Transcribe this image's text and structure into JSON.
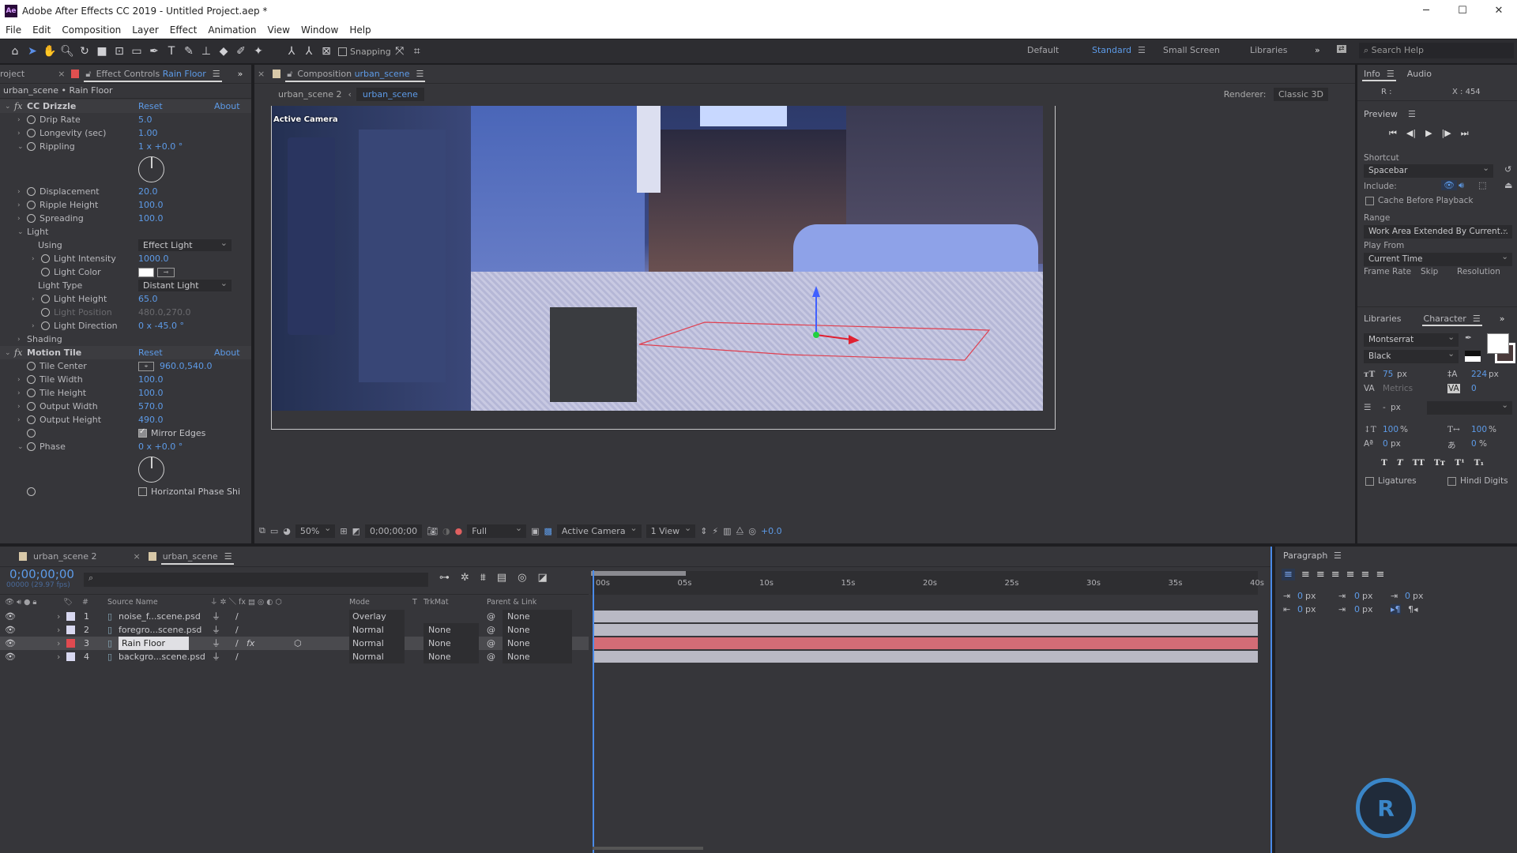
{
  "window": {
    "title": "Adobe After Effects CC 2019 - Untitled Project.aep *",
    "logo": "Ae",
    "controls": [
      "minimize-icon",
      "maximize-icon",
      "close-icon"
    ]
  },
  "menu": [
    "File",
    "Edit",
    "Composition",
    "Layer",
    "Effect",
    "Animation",
    "View",
    "Window",
    "Help"
  ],
  "toolbar": {
    "snapping": "Snapping",
    "workspaces": [
      "Default",
      "Standard",
      "Small Screen",
      "Libraries"
    ],
    "active_workspace": "Standard",
    "search_placeholder": "Search Help"
  },
  "effect_controls": {
    "project_tab": "roject",
    "tab_prefix": "Effect Controls",
    "tab_layer": "Rain Floor",
    "header": "urban_scene • Rain Floor",
    "reset": "Reset",
    "about": "About",
    "rows": [
      {
        "type": "header",
        "label": "CC Drizzle"
      },
      {
        "type": "value",
        "label": "Drip Rate",
        "value": "5.0",
        "exp": ">",
        "lvl": 1,
        "sw": true
      },
      {
        "type": "value",
        "label": "Longevity (sec)",
        "value": "1.00",
        "exp": ">",
        "lvl": 1,
        "sw": true
      },
      {
        "type": "value",
        "label": "Rippling",
        "value": "1 x +0.0 °",
        "exp": "v",
        "lvl": 1,
        "sw": true
      },
      {
        "type": "dial"
      },
      {
        "type": "value",
        "label": "Displacement",
        "value": "20.0",
        "exp": ">",
        "lvl": 1,
        "sw": true
      },
      {
        "type": "value",
        "label": "Ripple Height",
        "value": "100.0",
        "exp": ">",
        "lvl": 1,
        "sw": true
      },
      {
        "type": "value",
        "label": "Spreading",
        "value": "100.0",
        "exp": ">",
        "lvl": 1,
        "sw": true
      },
      {
        "type": "group",
        "label": "Light",
        "exp": "v",
        "lvl": 1
      },
      {
        "type": "dropdown",
        "label": "Using",
        "value": "Effect Light",
        "lvl": 2
      },
      {
        "type": "value",
        "label": "Light Intensity",
        "value": "1000.0",
        "exp": ">",
        "lvl": 2,
        "sw": true
      },
      {
        "type": "color",
        "label": "Light Color",
        "value": "#ffffff",
        "lvl": 2,
        "sw": true
      },
      {
        "type": "dropdown",
        "label": "Light Type",
        "value": "Distant Light",
        "lvl": 2
      },
      {
        "type": "value",
        "label": "Light Height",
        "value": "65.0",
        "exp": ">",
        "lvl": 2,
        "sw": true
      },
      {
        "type": "disabled",
        "label": "Light Position",
        "value": "480.0,270.0",
        "lvl": 2,
        "sw": true
      },
      {
        "type": "value",
        "label": "Light Direction",
        "value": "0 x -45.0 °",
        "exp": ">",
        "lvl": 2,
        "sw": true
      },
      {
        "type": "group",
        "label": "Shading",
        "exp": ">",
        "lvl": 1
      },
      {
        "type": "header",
        "label": "Motion Tile"
      },
      {
        "type": "point",
        "label": "Tile Center",
        "value": "960.0,540.0",
        "lvl": 1,
        "sw": true
      },
      {
        "type": "value",
        "label": "Tile Width",
        "value": "100.0",
        "exp": ">",
        "lvl": 1,
        "sw": true
      },
      {
        "type": "value",
        "label": "Tile Height",
        "value": "100.0",
        "exp": ">",
        "lvl": 1,
        "sw": true
      },
      {
        "type": "value",
        "label": "Output Width",
        "value": "570.0",
        "exp": ">",
        "lvl": 1,
        "sw": true
      },
      {
        "type": "value",
        "label": "Output Height",
        "value": "490.0",
        "exp": ">",
        "lvl": 1,
        "sw": true
      },
      {
        "type": "checkbox",
        "label": "",
        "value": "Mirror Edges",
        "checked": true,
        "lvl": 1,
        "sw": true
      },
      {
        "type": "value",
        "label": "Phase",
        "value": "0 x +0.0 °",
        "exp": "v",
        "lvl": 1,
        "sw": true
      },
      {
        "type": "dial"
      },
      {
        "type": "checkbox",
        "label": "",
        "value": "Horizontal Phase Shi",
        "checked": false,
        "lvl": 1,
        "sw": true
      }
    ]
  },
  "composition": {
    "tab_prefix": "Composition",
    "tab_name": "urban_scene",
    "subtabs": [
      "urban_scene 2",
      "urban_scene"
    ],
    "renderer_label": "Renderer:",
    "renderer": "Classic 3D",
    "view_label": "Active Camera",
    "bottom": {
      "zoom": "50%",
      "timecode": "0;00;00;00",
      "resolution": "Full",
      "camera": "Active Camera",
      "views": "1 View",
      "exposure": "+0.0"
    }
  },
  "info": {
    "tabs": [
      "Info",
      "Audio"
    ],
    "r": "R :",
    "x": "X : 454"
  },
  "preview": {
    "title": "Preview",
    "shortcut_label": "Shortcut",
    "shortcut": "Spacebar",
    "include_label": "Include:",
    "cache": "Cache Before Playback",
    "range_label": "Range",
    "range": "Work Area Extended By Current...",
    "play_from_label": "Play From",
    "play_from": "Current Time",
    "frame_rate": "Frame Rate",
    "skip": "Skip",
    "resolution": "Resolution"
  },
  "character": {
    "tabs": [
      "Libraries",
      "Character"
    ],
    "font": "Montserrat",
    "style": "Black",
    "size": "75",
    "size_unit": "px",
    "leading": "224",
    "leading_unit": "px",
    "kerning": "Metrics",
    "tracking": "0",
    "stroke": "-",
    "stroke_unit": "px",
    "vscale": "100",
    "hscale": "100",
    "pct": "%",
    "baseline": "0",
    "baseline_unit": "px",
    "tsume": "0",
    "ligatures": "Ligatures",
    "hindi": "Hindi Digits",
    "fill_color": "#ffffff",
    "stroke_color": "#ffffff"
  },
  "paragraph": {
    "title": "Paragraph",
    "values": [
      "0",
      "0",
      "0",
      "0",
      "0"
    ],
    "unit": "px"
  },
  "timeline": {
    "tabs": [
      "urban_scene 2",
      "urban_scene"
    ],
    "timecode": "0;00;00;00",
    "fps": "00000 (29.97 fps)",
    "columns": {
      "num": "#",
      "source": "Source Name",
      "mode": "Mode",
      "t": "T",
      "trkmat": "TrkMat",
      "parent": "Parent & Link"
    },
    "ruler": [
      "00s",
      "05s",
      "10s",
      "15s",
      "20s",
      "25s",
      "30s",
      "35s",
      "40s"
    ],
    "layers": [
      {
        "num": "1",
        "name": "noise_f...scene.psd",
        "label_color": "#d8d8f0",
        "mode": "Overlay",
        "trkmat": "",
        "parent": "None",
        "selected": false,
        "fx": false
      },
      {
        "num": "2",
        "name": "foregro...scene.psd",
        "label_color": "#d8d8f0",
        "mode": "Normal",
        "trkmat": "None",
        "parent": "None",
        "selected": false,
        "fx": false
      },
      {
        "num": "3",
        "name": "Rain Floor",
        "label_color": "#e04a50",
        "mode": "Normal",
        "trkmat": "None",
        "parent": "None",
        "selected": true,
        "fx": true
      },
      {
        "num": "4",
        "name": "backgro...scene.psd",
        "label_color": "#d8d8f0",
        "mode": "Normal",
        "trkmat": "None",
        "parent": "None",
        "selected": false,
        "fx": false
      }
    ]
  },
  "colors": {
    "accent": "#5d9be8",
    "selected_bar": "#d36c76",
    "layer_bar": "#b9b9c4"
  }
}
